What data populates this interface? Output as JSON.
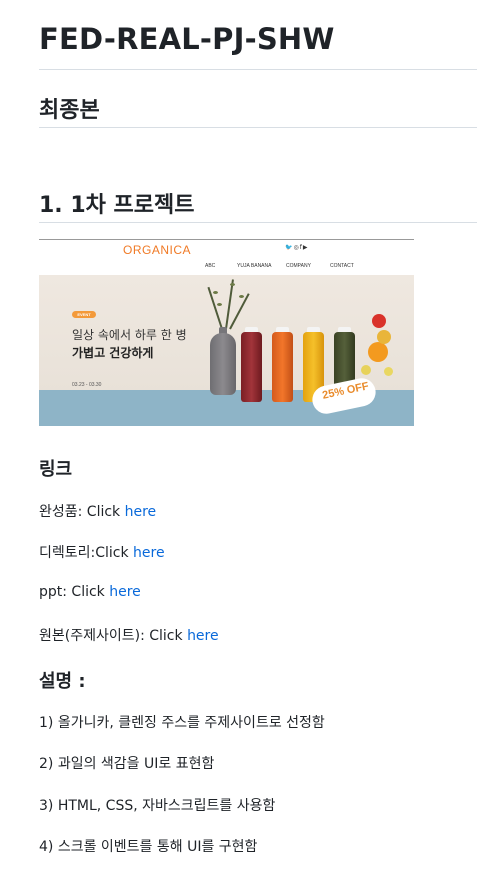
{
  "title": "FED-REAL-PJ-SHW",
  "subtitle": "최종본",
  "section_heading": "1. 1차 프로젝트",
  "banner": {
    "brand": "ORGANICA",
    "nav": [
      "ABC",
      "YUJA BANANA",
      "COMPANY",
      "CONTACT"
    ],
    "event_badge": "EVENT",
    "headline_line1": "일상 속에서 하루 한 병",
    "headline_line2": "가볍고 건강하게",
    "dates": "03.23 - 03.30",
    "sale": "25% OFF"
  },
  "links_heading": "링크",
  "links": [
    {
      "prefix": "완성품: Click ",
      "link_text": "here"
    },
    {
      "prefix": "디렉토리:Click ",
      "link_text": "here"
    },
    {
      "prefix": "ppt: Click ",
      "link_text": "here"
    },
    {
      "prefix": "원본(주제사이트): Click ",
      "link_text": "here"
    }
  ],
  "description_heading": "설명 :",
  "descriptions": [
    "1) 올가니카, 클렌징 주스를 주제사이트로 선정함",
    "2) 과일의 색감을 UI로 표현함",
    "3) HTML, CSS, 자바스크립트를 사용함",
    "4) 스크롤 이벤트를 통해 UI를 구현함"
  ],
  "colors": {
    "link": "#0969da",
    "brand_orange": "#f07a26",
    "text": "#1f2328"
  }
}
